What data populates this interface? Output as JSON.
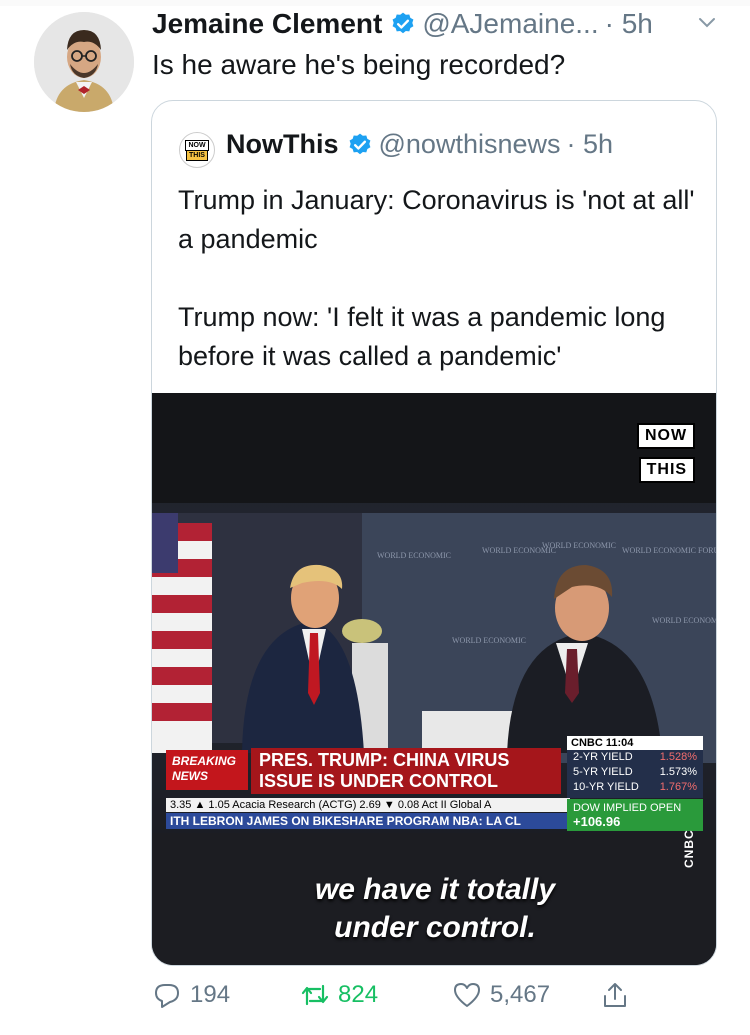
{
  "tweet": {
    "author_name": "Jemaine Clement",
    "author_handle": "@AJemaine...",
    "time": "· 5h",
    "text": "Is he aware he's being recorded?",
    "replies": "194",
    "retweets": "824",
    "likes": "5,467"
  },
  "quoted": {
    "author_name": "NowThis",
    "author_handle": "@nowthisnews",
    "time": "· 5h",
    "text": "Trump in January: Coronavirus is 'not at all' a pandemic\n\nTrump now: 'I felt it was a pandemic long before it was called a pandemic'",
    "logo_line1": "NOW",
    "logo_line2": "THIS"
  },
  "video": {
    "badge_line1": "NOW",
    "badge_line2": "THIS",
    "subtitle": "we have it totally\nunder control.",
    "breaking": "BREAKING NEWS",
    "headline": "PRES. TRUMP: CHINA VIRUS\nISSUE IS UNDER CONTROL",
    "ticker1": "3.35 ▲ 1.05   Acacia Research (ACTG) 2.69 ▼ 0.08   Act II Global A",
    "ticker2": "ITH LEBRON JAMES ON BIKESHARE PROGRAM   NBA: LA CL",
    "cnbc_title": "CNBC 11:04",
    "yield_rows": [
      {
        "label": "2-YR YIELD",
        "value": "1.528%"
      },
      {
        "label": "5-YR YIELD",
        "value": "1.573%"
      },
      {
        "label": "10-YR YIELD",
        "value": "1.767%"
      }
    ],
    "dow_label": "DOW IMPLIED OPEN",
    "dow_value": "+106.96",
    "watermark": "CNBC",
    "backdrop_text": "WORLD ECONOMIC FORUM"
  },
  "colors": {
    "verified": "#1da1f2",
    "meta": "#657786",
    "border": "#ccd6dd"
  }
}
